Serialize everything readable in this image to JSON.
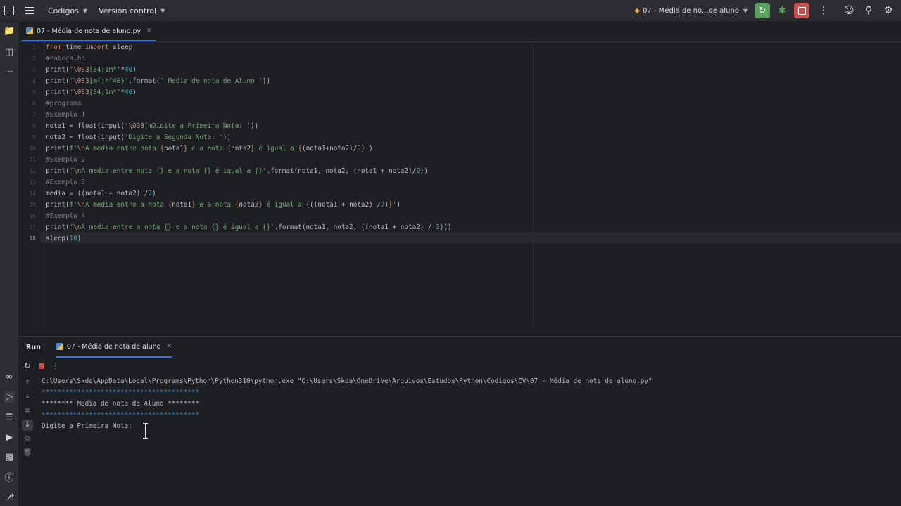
{
  "titlebar": {
    "project": "Codigos",
    "vcs": "Version control",
    "run_config": "07 - Média de no...de aluno"
  },
  "editor": {
    "tab_label": "07 - Média de nota de aluno.py",
    "line_numbers": [
      "1",
      "2",
      "3",
      "4",
      "5",
      "6",
      "7",
      "8",
      "9",
      "10",
      "11",
      "12",
      "13",
      "14",
      "15",
      "16",
      "17",
      "18"
    ],
    "current_line": 18
  },
  "run_panel": {
    "title": "Run",
    "tab_label": "07 - Média de nota de aluno",
    "console": {
      "command": "C:\\Users\\Skda\\AppData\\Local\\Programs\\Python\\Python310\\python.exe \"C:\\Users\\Skda\\OneDrive\\Arquivos\\Estudos\\Python\\Codigos\\CV\\07 - Média de nota de aluno.py\"",
      "line1": "****************************************",
      "line2": "******** Media de nota de Aluno ********",
      "line3": "****************************************",
      "prompt": "Digite a Primeira Nota: "
    }
  },
  "colors": {
    "accent": "#3574f0",
    "rerun": "#5aa061",
    "stop": "#c94f4f",
    "console_ansi_blue": "#3d8fd9"
  }
}
